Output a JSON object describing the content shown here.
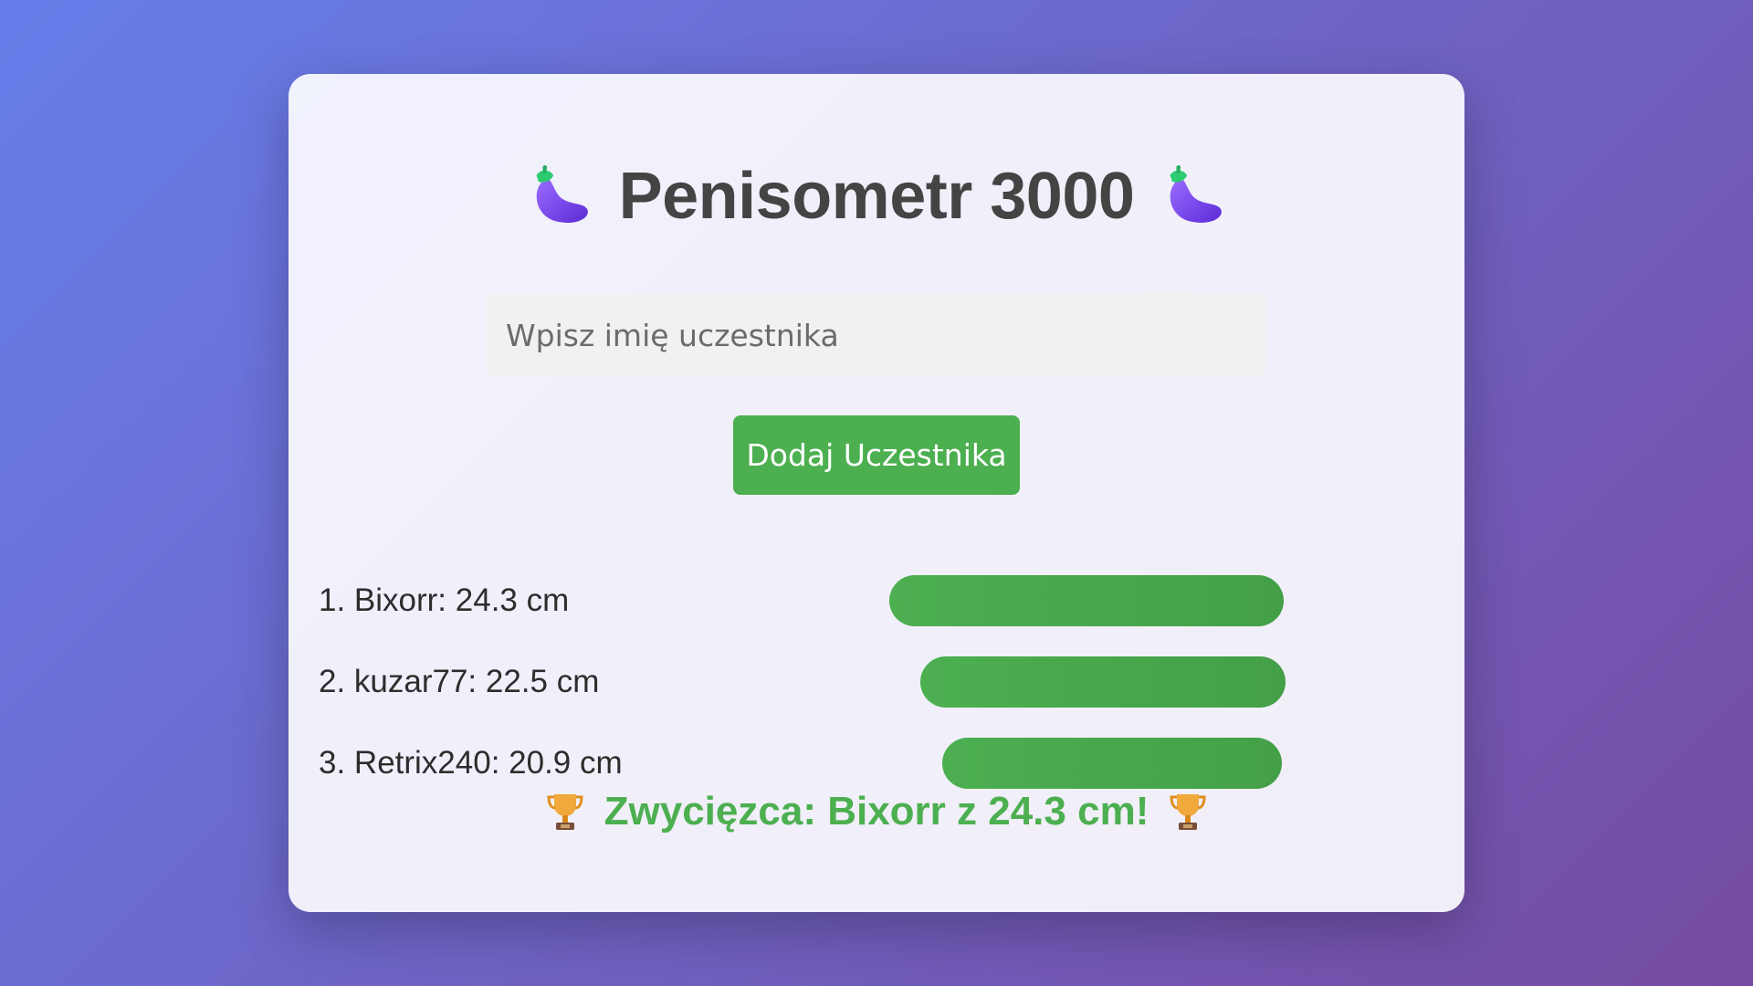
{
  "app": {
    "title": "Penisometr 3000",
    "title_icon": "eggplant-icon"
  },
  "form": {
    "name_placeholder": "Wpisz imię uczestnika",
    "name_value": "",
    "add_button_label": "Dodaj Uczestnika"
  },
  "leaderboard": {
    "entries": [
      {
        "label": "1. Bixorr: 24.3 cm",
        "name": "Bixorr",
        "length_cm": 24.3
      },
      {
        "label": "2. kuzar77: 22.5 cm",
        "name": "kuzar77",
        "length_cm": 22.5
      },
      {
        "label": "3. Retrix240: 20.9 cm",
        "name": "Retrix240",
        "length_cm": 20.9
      }
    ]
  },
  "winner": {
    "text": "Zwycięzca: Bixorr z 24.3 cm!",
    "icon": "trophy-icon"
  },
  "colors": {
    "accent": "#4caf50",
    "title": "#444444",
    "background_from": "#667eea",
    "background_to": "#764ba2"
  }
}
